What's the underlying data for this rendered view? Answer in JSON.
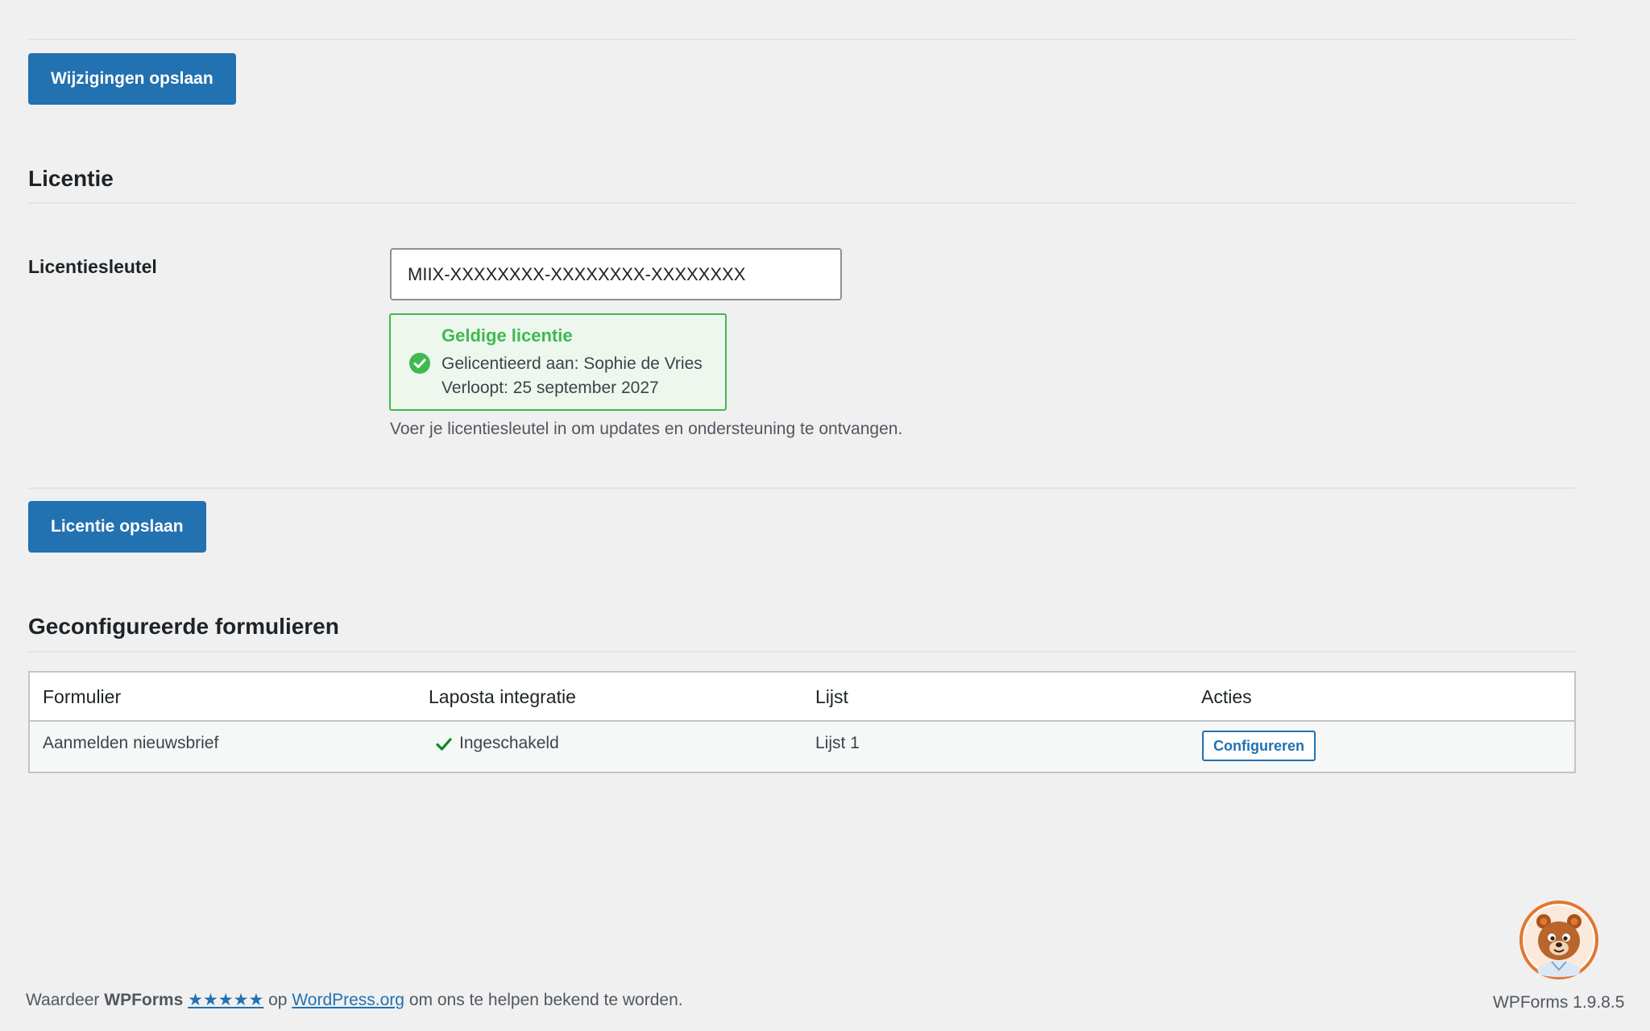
{
  "buttons": {
    "save_changes": "Wijzigingen opslaan",
    "save_license": "Licentie opslaan"
  },
  "license_section": {
    "title": "Licentie",
    "field_label": "Licentiesleutel",
    "key_value": "MIIX-XXXXXXXX-XXXXXXXX-XXXXXXXX",
    "notice": {
      "title": "Geldige licentie",
      "licensed_to": "Gelicentieerd aan: Sophie de Vries",
      "expires": "Verloopt: 25 september 2027"
    },
    "description": "Voer je licentiesleutel in om updates en ondersteuning te ontvangen."
  },
  "forms_section": {
    "title": "Geconfigureerde formulieren",
    "columns": [
      "Formulier",
      "Laposta integratie",
      "Lijst",
      "Acties"
    ],
    "rows": [
      {
        "form": "Aanmelden nieuwsbrief",
        "integration": "Ingeschakeld",
        "list": "Lijst 1",
        "action": "Configureren"
      }
    ]
  },
  "footer": {
    "prefix": "Waardeer",
    "brand": "WPForms",
    "stars": "★★★★★",
    "on": "op",
    "link": "WordPress.org",
    "suffix": "om ons te helpen bekend te worden.",
    "version": "WPForms 1.9.8.5"
  },
  "icons": {
    "valid_license": "check-circle-icon",
    "enabled": "checkmark-icon",
    "mascot": "bear-mascot-icon"
  },
  "colors": {
    "primary": "#2271b1",
    "success": "#3fb950",
    "background": "#f0f0f1"
  }
}
